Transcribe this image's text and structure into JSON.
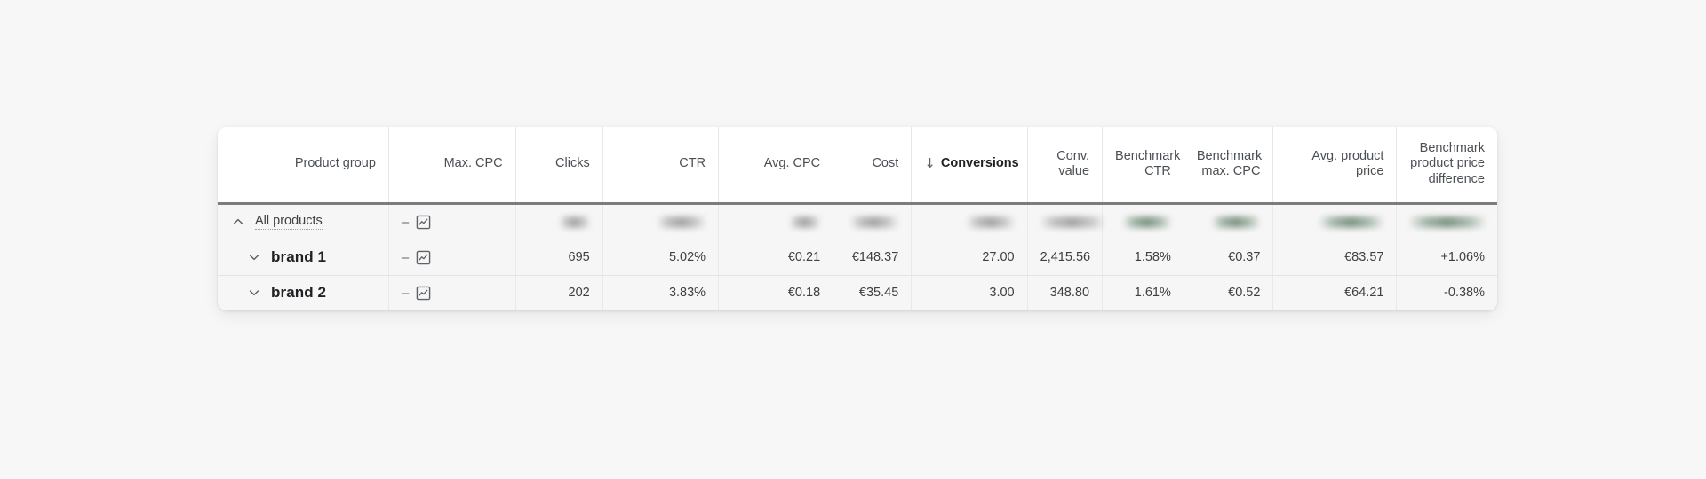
{
  "table": {
    "columns": [
      {
        "key": "product_group",
        "label": "Product group",
        "align": "center",
        "green": false,
        "sorted": false
      },
      {
        "key": "max_cpc",
        "label": "Max. CPC",
        "align": "left",
        "green": false,
        "sorted": false
      },
      {
        "key": "clicks",
        "label": "Clicks",
        "align": "right",
        "green": false,
        "sorted": false
      },
      {
        "key": "ctr",
        "label": "CTR",
        "align": "right",
        "green": false,
        "sorted": false
      },
      {
        "key": "avg_cpc",
        "label": "Avg. CPC",
        "align": "right",
        "green": false,
        "sorted": false
      },
      {
        "key": "cost",
        "label": "Cost",
        "align": "right",
        "green": false,
        "sorted": false
      },
      {
        "key": "conversions",
        "label": "Conversions",
        "align": "right",
        "green": false,
        "sorted": true,
        "sort_direction": "desc",
        "sort_arrow": "↓"
      },
      {
        "key": "conv_value",
        "label": "Conv. value",
        "align": "right",
        "green": false,
        "sorted": false
      },
      {
        "key": "benchmark_ctr",
        "label": "Benchmark CTR",
        "align": "right",
        "green": true,
        "sorted": false
      },
      {
        "key": "benchmark_cpc",
        "label": "Benchmark max. CPC",
        "align": "right",
        "green": true,
        "sorted": false
      },
      {
        "key": "avg_price",
        "label": "Avg. product price",
        "align": "right",
        "green": true,
        "sorted": false
      },
      {
        "key": "price_diff",
        "label": "Benchmark product price difference",
        "align": "right",
        "green": true,
        "sorted": false
      }
    ],
    "rows": [
      {
        "type": "all",
        "expand_icon": "chevron-up-icon",
        "expanded": true,
        "label": "All products",
        "max_cpc_dash": "–",
        "max_cpc_icon": "line-chart-icon",
        "redacted": true,
        "clicks": "",
        "ctr": "",
        "avg_cpc": "",
        "cost": "",
        "conversions": "",
        "conv_value": "",
        "benchmark_ctr": "",
        "benchmark_cpc": "",
        "avg_price": "",
        "price_diff": ""
      },
      {
        "type": "brand",
        "expand_icon": "chevron-down-icon",
        "expanded": false,
        "label": "brand 1",
        "max_cpc_dash": "–",
        "max_cpc_icon": "line-chart-icon",
        "redacted": false,
        "clicks": "695",
        "ctr": "5.02%",
        "avg_cpc": "€0.21",
        "cost": "€148.37",
        "conversions": "27.00",
        "conv_value": "2,415.56",
        "benchmark_ctr": "1.58%",
        "benchmark_cpc": "€0.37",
        "avg_price": "€83.57",
        "price_diff": "+1.06%"
      },
      {
        "type": "brand",
        "expand_icon": "chevron-down-icon",
        "expanded": false,
        "label": "brand 2",
        "max_cpc_dash": "–",
        "max_cpc_icon": "line-chart-icon",
        "redacted": false,
        "clicks": "202",
        "ctr": "3.83%",
        "avg_cpc": "€0.18",
        "cost": "€35.45",
        "conversions": "3.00",
        "conv_value": "348.80",
        "benchmark_ctr": "1.61%",
        "benchmark_cpc": "€0.52",
        "avg_price": "€64.21",
        "price_diff": "-0.38%"
      }
    ]
  },
  "colors": {
    "page_background": "#f7f7f7",
    "header_background": "#ffffff",
    "row_background": "#f6f6f6",
    "benchmark_header_background": "#e4f0e6",
    "benchmark_cell_background": "#d4e7d8",
    "header_rule": "#7a7d80",
    "benchmark_header_rule": "#3f6a4b",
    "text_primary": "#3c4043",
    "text_strong": "#202124"
  }
}
